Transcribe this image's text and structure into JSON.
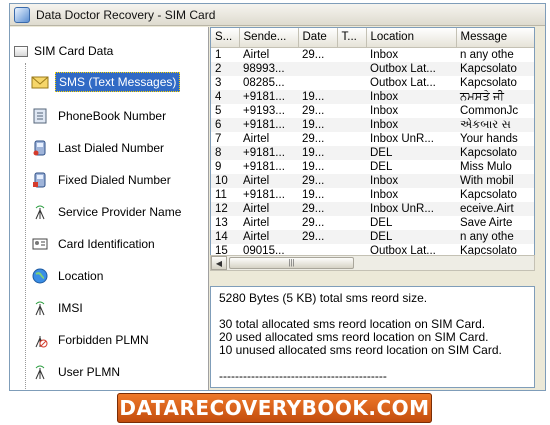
{
  "window": {
    "title": "Data Doctor Recovery - SIM Card"
  },
  "tree": {
    "root_label": "SIM Card Data",
    "items": [
      {
        "label": "SMS (Text Messages)",
        "icon": "envelope-icon",
        "selected": true
      },
      {
        "label": "PhoneBook Number",
        "icon": "phonebook-icon"
      },
      {
        "label": "Last Dialed Number",
        "icon": "phone-dial-icon"
      },
      {
        "label": "Fixed Dialed Number",
        "icon": "phone-fixed-icon"
      },
      {
        "label": "Service Provider Name",
        "icon": "antenna-icon"
      },
      {
        "label": "Card Identification",
        "icon": "id-card-icon"
      },
      {
        "label": "Location",
        "icon": "globe-icon"
      },
      {
        "label": "IMSI",
        "icon": "antenna-icon"
      },
      {
        "label": "Forbidden PLMN",
        "icon": "antenna-forbidden-icon"
      },
      {
        "label": "User PLMN",
        "icon": "antenna-icon"
      }
    ]
  },
  "grid": {
    "columns": [
      "S...",
      "Sende...",
      "Date",
      "T...",
      "Location",
      "Message"
    ],
    "rows": [
      [
        "1",
        "Airtel",
        "29...",
        "",
        "Inbox",
        "n any othe"
      ],
      [
        "2",
        "98993...",
        "",
        "",
        "Outbox Lat...",
        "Kapcsolato"
      ],
      [
        "3",
        "08285...",
        "",
        "",
        "Outbox Lat...",
        "Kapcsolato"
      ],
      [
        "4",
        "+9181...",
        "19...",
        "",
        "Inbox",
        "ਨਮਸਤੇ ਜੀ"
      ],
      [
        "5",
        "+9193...",
        "29...",
        "",
        "Inbox",
        "CommonJc"
      ],
      [
        "6",
        "+9181...",
        "19...",
        "",
        "Inbox",
        "એકબાર સ"
      ],
      [
        "7",
        "Airtel",
        "29...",
        "",
        "Inbox UnR...",
        "Your hands"
      ],
      [
        "8",
        "+9181...",
        "19...",
        "",
        "DEL",
        "Kapcsolato"
      ],
      [
        "9",
        "+9181...",
        "19...",
        "",
        "DEL",
        " Miss Mulo"
      ],
      [
        "10",
        "Airtel",
        "29...",
        "",
        "Inbox",
        "With mobil"
      ],
      [
        "11",
        "+9181...",
        "19...",
        "",
        "Inbox",
        "Kapcsolato"
      ],
      [
        "12",
        "Airtel",
        "29...",
        "",
        "Inbox UnR...",
        "eceive.Airt"
      ],
      [
        "13",
        "Airtel",
        "29...",
        "",
        "DEL",
        "Save Airte"
      ],
      [
        "14",
        "Airtel",
        "29...",
        "",
        "DEL",
        "n any othe"
      ],
      [
        "15",
        "09015...",
        "",
        "",
        "Outbox Lat...",
        "Kapcsolato"
      ]
    ]
  },
  "scrollbar": {
    "thumb_glyph": "|||"
  },
  "info": {
    "size_line": "5280 Bytes (5 KB) total sms reord size.",
    "total_line": "30 total allocated sms reord location on SIM Card.",
    "used_line": "20 used allocated sms reord location on SIM Card.",
    "unused_line": "10 unused allocated sms reord location on SIM Card.",
    "separator": "------------------------------------------"
  },
  "banner": {
    "text": "DATARECOVERYBOOK.COM"
  },
  "colors": {
    "selection": "#316ac5",
    "banner": "#d9601a"
  }
}
